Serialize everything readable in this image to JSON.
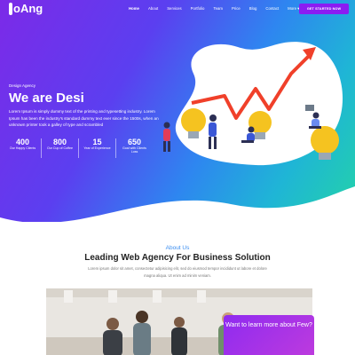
{
  "brand": {
    "name": "oAng"
  },
  "nav": {
    "items": [
      {
        "label": "Home",
        "active": true
      },
      {
        "label": "About"
      },
      {
        "label": "Services"
      },
      {
        "label": "Portfolio"
      },
      {
        "label": "Team"
      },
      {
        "label": "Price"
      },
      {
        "label": "Blog"
      },
      {
        "label": "Contact"
      },
      {
        "label": "More ▾"
      }
    ],
    "cta_label": "GET STARTED NOW"
  },
  "hero": {
    "eyebrow": "Design Agency",
    "headline": "We are Desi",
    "lead": "Lorem Ipsum is simply dummy text of the printing and typesetting industry. Lorem Ipsum has been the industry's standard dummy text ever since the 1500s, when an unknown printer took a galley of type and scrambled",
    "stats": [
      {
        "value": "400",
        "label": "Our Happy Clients"
      },
      {
        "value": "800",
        "label": "Our Cup of Coffee"
      },
      {
        "value": "15",
        "label": "Year of Experience"
      },
      {
        "value": "650",
        "label": "Goal with Clients Loss"
      }
    ]
  },
  "about": {
    "eyebrow": "About Us",
    "title": "Leading Web Agency For Business Solution",
    "text": "Lorem ipsum dolor sit amet, consectetur adipisicing elit, sed do eiusmod tempor incididunt ut labore et dolore magna aliqua. Ut enim ad minim veniam."
  },
  "promo": {
    "title": "Want to learn more about Few?"
  },
  "colors": {
    "gradient_start": "#7c2ae8",
    "gradient_end": "#23d3a8",
    "cta": "#8b1cf2",
    "accent_blue": "#3b8ef0",
    "arrow_red": "#f0402a",
    "bulb_yellow": "#f5c320"
  }
}
